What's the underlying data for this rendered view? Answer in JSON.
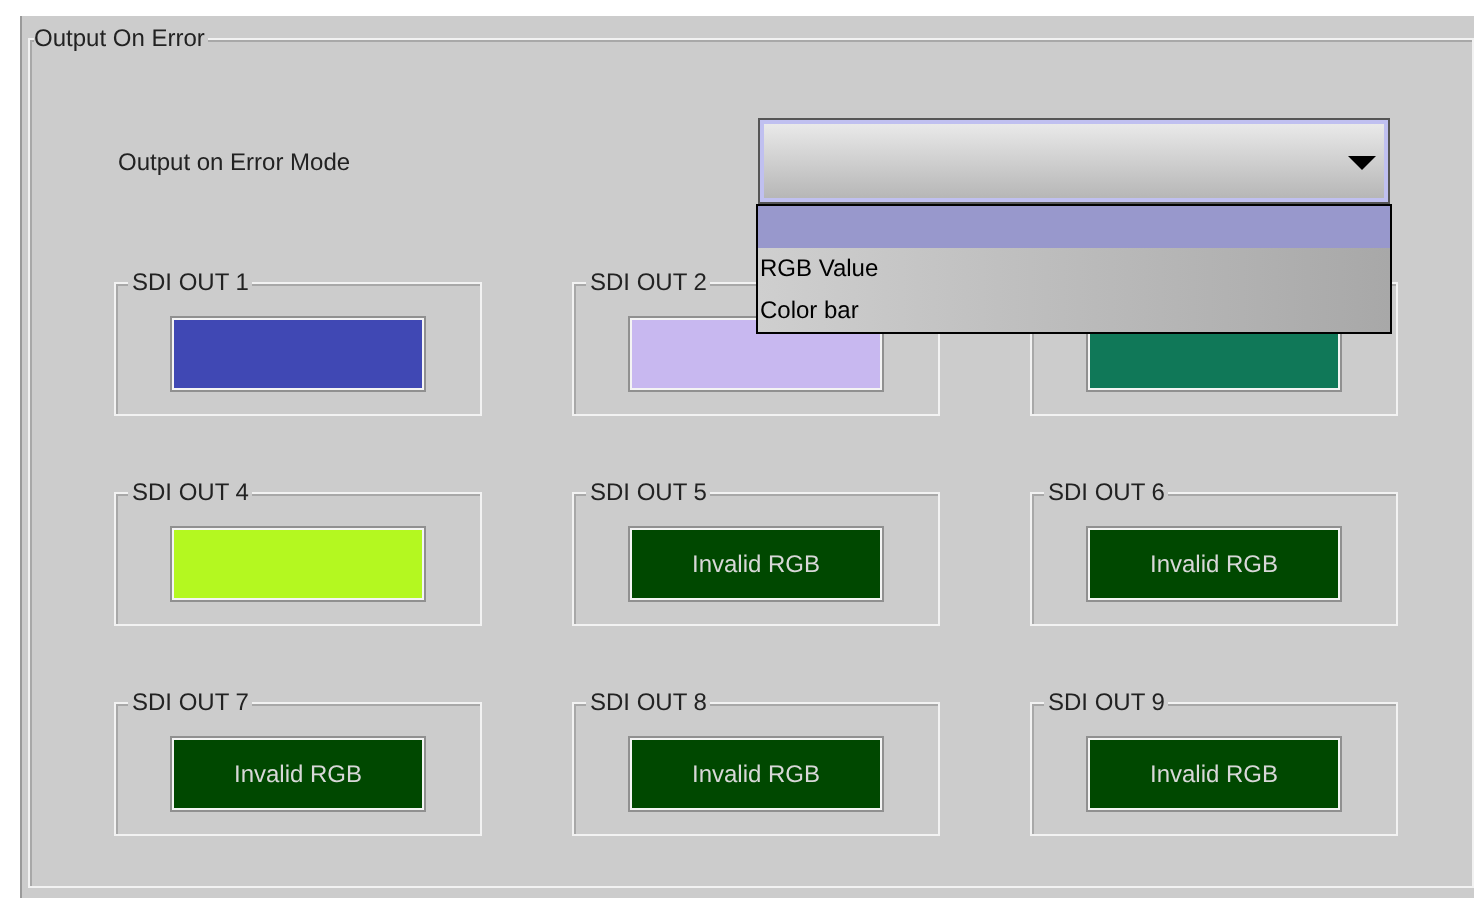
{
  "group": {
    "title": "Output On Error"
  },
  "mode": {
    "label": "Output on Error Mode",
    "expanded": true,
    "options": [
      {
        "selected": true
      },
      {
        "label": "RGB Value",
        "selected": false
      },
      {
        "label": "Color bar",
        "selected": false
      }
    ]
  },
  "outputs": [
    {
      "label": "SDI OUT 1",
      "kind": "color",
      "color": "#4048b4"
    },
    {
      "label": "SDI OUT 2",
      "kind": "color",
      "color": "#c8b8f0"
    },
    {
      "kind": "color",
      "color": "#107858"
    },
    {
      "label": "SDI OUT 4",
      "kind": "color",
      "color": "#b4f820"
    },
    {
      "label": "SDI OUT 5",
      "kind": "invalid",
      "text": "Invalid RGB"
    },
    {
      "label": "SDI OUT 6",
      "kind": "invalid",
      "text": "Invalid RGB"
    },
    {
      "label": "SDI OUT 7",
      "kind": "invalid",
      "text": "Invalid RGB"
    },
    {
      "label": "SDI OUT 8",
      "kind": "invalid",
      "text": "Invalid RGB"
    },
    {
      "label": "SDI OUT 9",
      "kind": "invalid",
      "text": "Invalid RGB"
    }
  ]
}
